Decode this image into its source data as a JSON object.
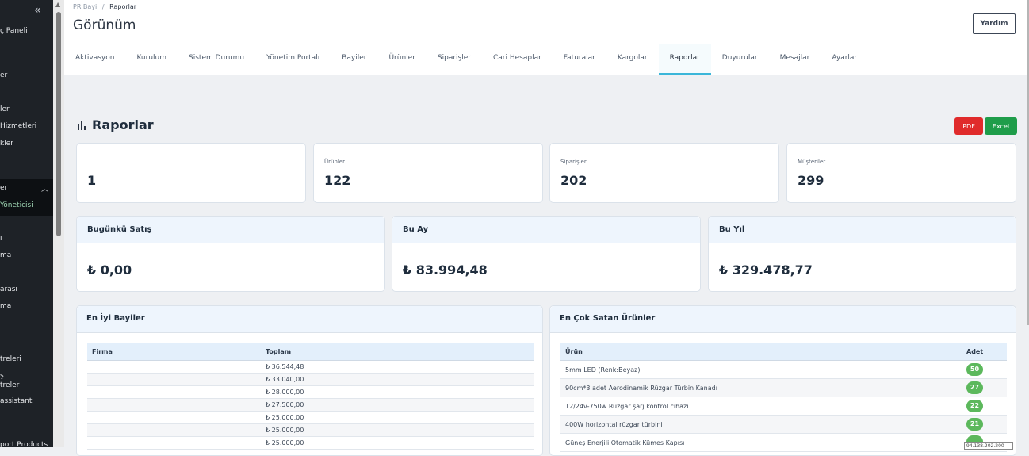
{
  "sidebar": {
    "collapse_icon": "double-chevron-left-icon",
    "items": [
      {
        "label": "ç Paneli"
      },
      {
        "label": "er"
      },
      {
        "label": "ler"
      },
      {
        "label": "Hizmetleri"
      },
      {
        "label": "kler"
      },
      {
        "label": "er"
      },
      {
        "label": "Yöneticisi"
      },
      {
        "label": "ı"
      },
      {
        "label": "ma"
      },
      {
        "label": "arası"
      },
      {
        "label": "ma"
      },
      {
        "label": "treleri"
      },
      {
        "label": "ş"
      },
      {
        "label": "treler"
      },
      {
        "label": "assistant"
      },
      {
        "label": "port Products"
      }
    ]
  },
  "header": {
    "breadcrumb_root": "PR Bayi",
    "breadcrumb_sep": "/",
    "breadcrumb_current": "Raporlar",
    "title": "Görünüm",
    "help_label": "Yardım"
  },
  "tabs": [
    {
      "label": "Aktivasyon"
    },
    {
      "label": "Kurulum"
    },
    {
      "label": "Sistem Durumu"
    },
    {
      "label": "Yönetim Portalı"
    },
    {
      "label": "Bayiler"
    },
    {
      "label": "Ürünler"
    },
    {
      "label": "Siparişler"
    },
    {
      "label": "Cari Hesaplar"
    },
    {
      "label": "Faturalar"
    },
    {
      "label": "Kargolar"
    },
    {
      "label": "Raporlar"
    },
    {
      "label": "Duyurular"
    },
    {
      "label": "Mesajlar"
    },
    {
      "label": "Ayarlar"
    }
  ],
  "reports": {
    "title": "Raporlar",
    "pdf_label": "PDF",
    "excel_label": "Excel"
  },
  "stats": [
    {
      "label": "",
      "value": "1"
    },
    {
      "label": "Ürünler",
      "value": "122"
    },
    {
      "label": "Siparişler",
      "value": "202"
    },
    {
      "label": "Müşteriler",
      "value": "299"
    }
  ],
  "sales": [
    {
      "label": "Bugünkü Satış",
      "value": "₺ 0,00"
    },
    {
      "label": "Bu Ay",
      "value": "₺ 83.994,48"
    },
    {
      "label": "Bu Yıl",
      "value": "₺ 329.478,77"
    }
  ],
  "top_dealers": {
    "title": "En İyi Bayiler",
    "headers": [
      "Firma",
      "Toplam"
    ],
    "rows": [
      {
        "firm": "",
        "total": "₺ 36.544,48"
      },
      {
        "firm": "",
        "total": "₺ 33.040,00"
      },
      {
        "firm": "",
        "total": "₺ 28.000,00"
      },
      {
        "firm": "",
        "total": "₺ 27.500,00"
      },
      {
        "firm": "",
        "total": "₺ 25.000,00"
      },
      {
        "firm": "",
        "total": "₺ 25.000,00"
      },
      {
        "firm": "",
        "total": "₺ 25.000,00"
      }
    ]
  },
  "top_products": {
    "title": "En Çok Satan Ürünler",
    "headers": [
      "Ürün",
      "Adet"
    ],
    "rows": [
      {
        "name": "5mm LED (Renk:Beyaz)",
        "qty": "50"
      },
      {
        "name": "90cm*3 adet Aerodinamik Rüzgar Türbin Kanadı",
        "qty": "27"
      },
      {
        "name": "12/24v-750w Rüzgar şarj kontrol cihazı",
        "qty": "22"
      },
      {
        "name": "400W horizontal rüzgar türbini",
        "qty": "21"
      },
      {
        "name": "Güneş Enerjili Otomatik Kümes Kapısı",
        "qty": ""
      }
    ]
  },
  "tooltip": "94.138.202.200"
}
